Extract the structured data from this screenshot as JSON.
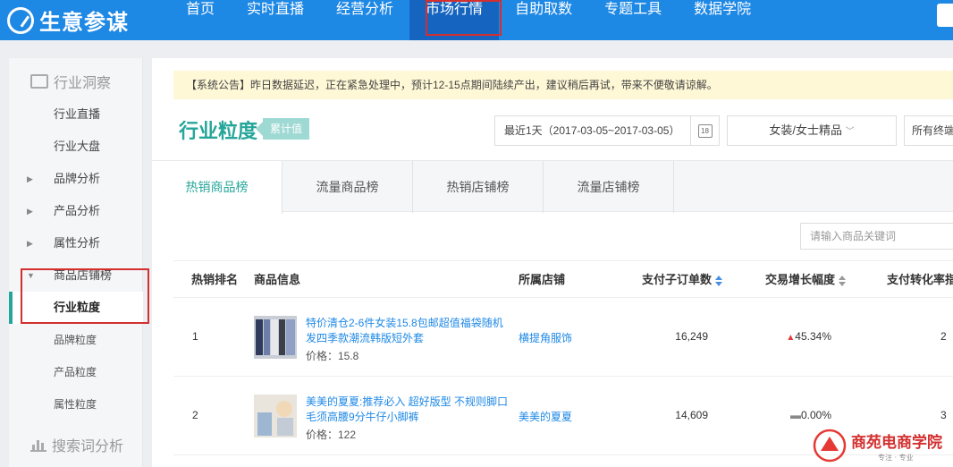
{
  "app": {
    "logo_text": "生意参谋",
    "nav": [
      "首页",
      "实时直播",
      "经营分析",
      "市场行情",
      "自助取数",
      "专题工具",
      "数据学院"
    ],
    "active_nav": "市场行情"
  },
  "sidebar": {
    "section1": "行业洞察",
    "items": [
      {
        "label": "行业直播"
      },
      {
        "label": "行业大盘"
      },
      {
        "label": "品牌分析"
      },
      {
        "label": "产品分析"
      },
      {
        "label": "属性分析"
      },
      {
        "label": "商品店铺榜"
      },
      {
        "label": "行业粒度"
      },
      {
        "label": "品牌粒度"
      },
      {
        "label": "产品粒度"
      },
      {
        "label": "属性粒度"
      }
    ],
    "section2": "搜索词分析"
  },
  "notice": "【系统公告】昨日数据延迟，正在紧急处理中，预计12-15点期间陆续产出，建议稍后再试，带来不便敬请谅解。",
  "page": {
    "title": "行业粒度",
    "badge": "累计值",
    "date_range": "最近1天（2017-03-05~2017-03-05）",
    "calendar_day": "18",
    "category": "女装/女士精品",
    "more_filter": "所有终端"
  },
  "tabs": [
    "热销商品榜",
    "流量商品榜",
    "热销店铺榜",
    "流量店铺榜"
  ],
  "search": {
    "placeholder": "请输入商品关键词"
  },
  "table": {
    "headers": [
      "热销排名",
      "商品信息",
      "所属店铺",
      "支付子订单数",
      "交易增长幅度",
      "支付转化率指"
    ],
    "rows": [
      {
        "rank": "1",
        "name": "特价清仓2-6件女装15.8包邮超值福袋随机发四季款潮流韩版短外套",
        "price": "价格：15.8",
        "shop": "横提角服饰",
        "orders": "16,249",
        "growth": "45.34%",
        "conv": "2"
      },
      {
        "rank": "2",
        "name": "美美的夏夏:推荐必入 超好版型 不规则脚口毛须高腰9分牛仔小脚裤",
        "price": "价格：122",
        "shop": "美美的夏夏",
        "orders": "14,609",
        "growth": "0.00%",
        "conv": "3"
      }
    ]
  },
  "watermark": {
    "text": "商苑电商学院",
    "sub": "专注 · 专业"
  },
  "colors": {
    "nav": "#1e88e5",
    "accent": "#26a69a",
    "highlight": "#d32f2f"
  }
}
